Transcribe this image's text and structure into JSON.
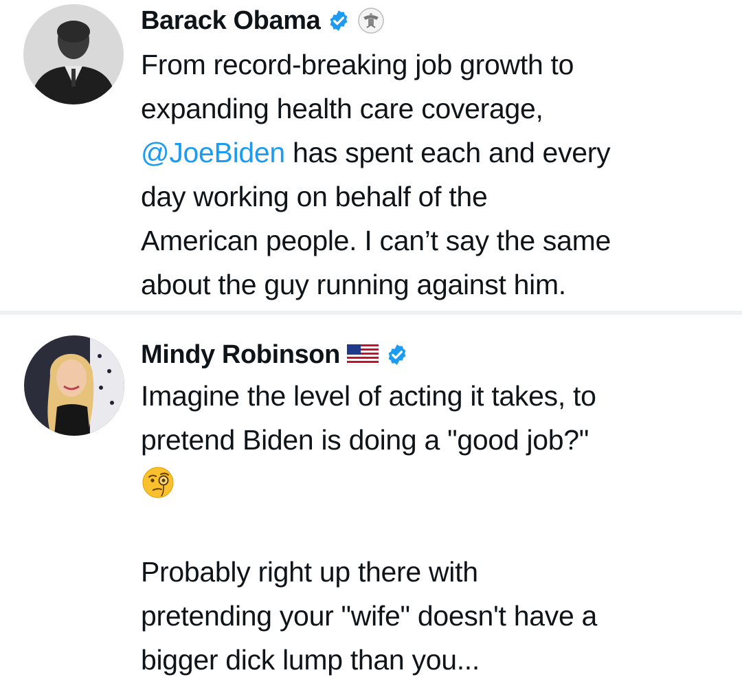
{
  "tweets": [
    {
      "author": "Barack Obama",
      "badges": [
        "verified-icon",
        "seal-icon"
      ],
      "text_pre": "From record-breaking job growth to\nexpanding health care coverage,\n",
      "mention": "@JoeBiden",
      "text_post": " has spent each and every\nday working on behalf of the\nAmerican people. I can’t say the same\nabout the guy running against him."
    },
    {
      "author": "Mindy Robinson",
      "badges": [
        "us-flag-icon",
        "verified-icon"
      ],
      "text_main": "Imagine the level of acting it takes, to\npretend Biden is doing a \"good job?\"",
      "emoji": "face-with-monocle-icon",
      "text_second": "Probably right up there with\npretending your \"wife\" doesn't have a\nbigger dick lump than you..."
    }
  ],
  "colors": {
    "mention": "#1d9bf0",
    "verified_badge": "#1d9bf0",
    "text": "#0f1419"
  }
}
